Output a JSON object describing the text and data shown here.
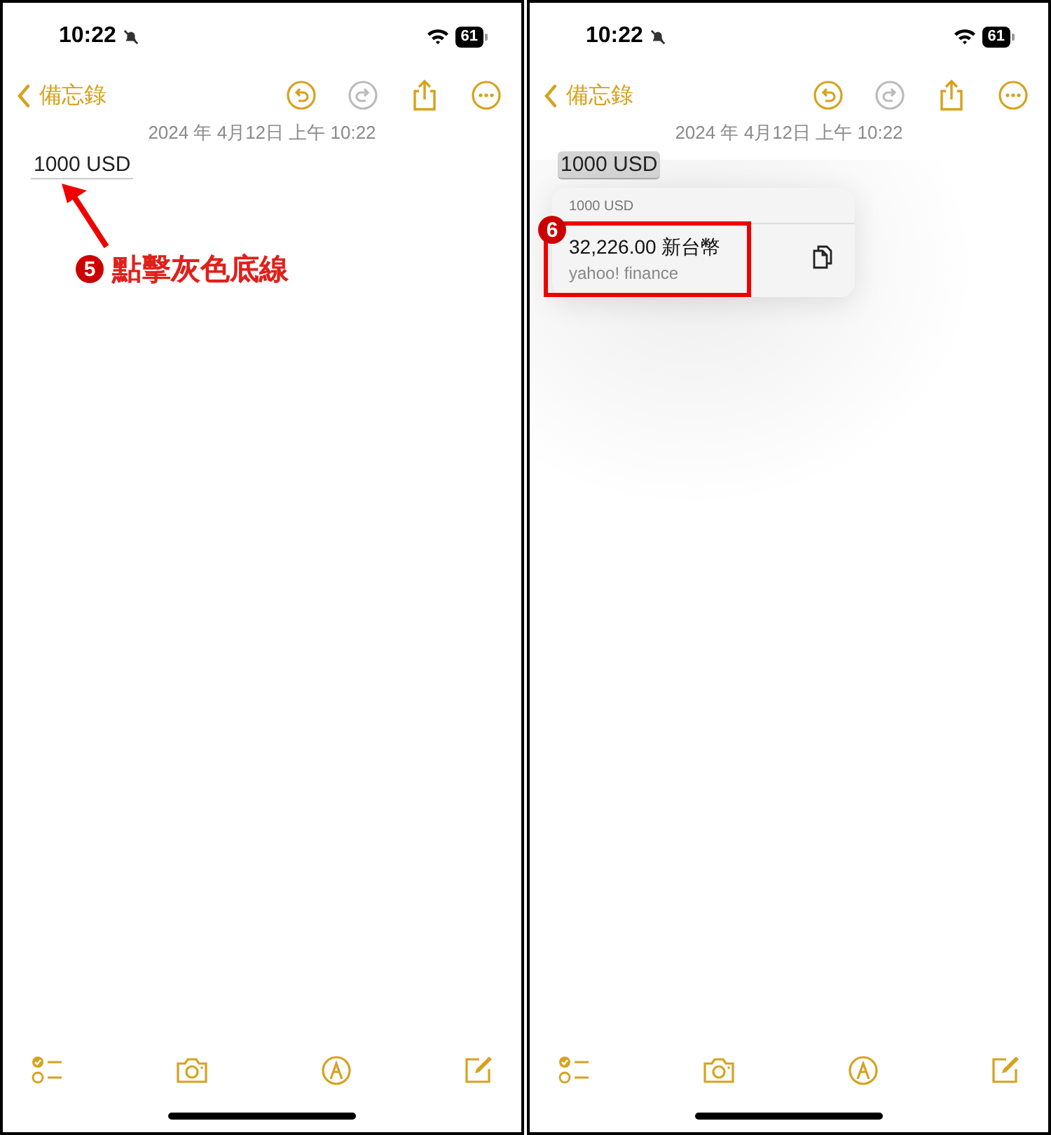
{
  "screens": [
    {
      "status_bar": {
        "time": "10:22",
        "battery": "61"
      },
      "nav": {
        "back": "備忘錄",
        "redo_disabled": true
      },
      "date": "2024 年 4月12日 上午 10:22",
      "note": {
        "text": "1000 USD",
        "selected": false
      },
      "annotation": {
        "number": "5",
        "label": "點擊灰色底線"
      }
    },
    {
      "status_bar": {
        "time": "10:22",
        "battery": "61"
      },
      "nav": {
        "back": "備忘錄",
        "redo_disabled": true
      },
      "date": "2024 年 4月12日 上午 10:22",
      "note": {
        "text": "1000 USD",
        "selected": true
      },
      "popup": {
        "header": "1000 USD",
        "result": "32,226.00 新台幣",
        "source": "yahoo! finance",
        "callout_number": "6"
      }
    }
  ]
}
